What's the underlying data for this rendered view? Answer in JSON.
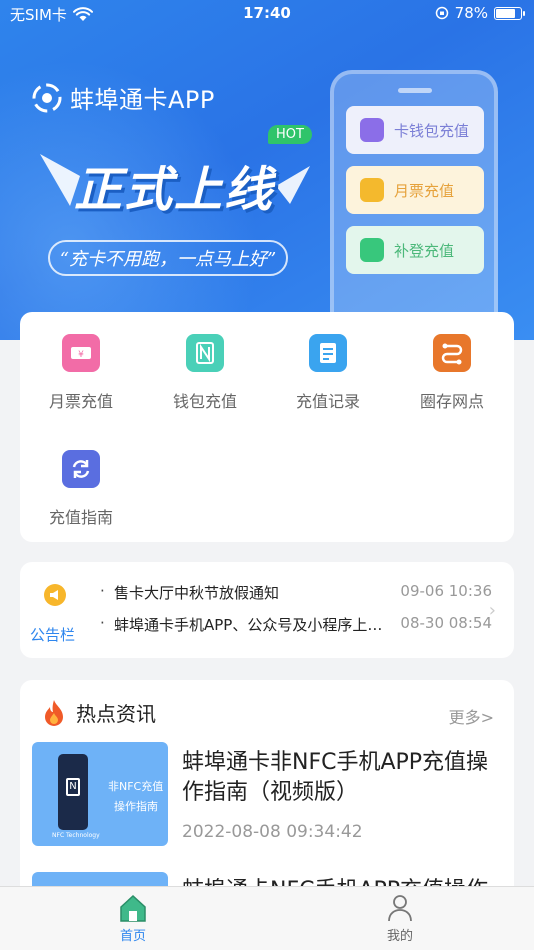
{
  "status_bar": {
    "carrier": "无SIM卡",
    "time": "17:40",
    "battery": "78%"
  },
  "banner": {
    "app_name": "蚌埠通卡APP",
    "slogan_main": "正式上线",
    "hot_badge": "HOT",
    "slogan_sub": "“充卡不用跑，一点马上好”",
    "phone_buttons": [
      {
        "label": "卡钱包充值",
        "icon": "wallet-icon",
        "bg": "#eef0fb",
        "color": "#7b7fd6",
        "icon_color": "#8b6ee8"
      },
      {
        "label": "月票充值",
        "icon": "calendar-icon",
        "bg": "#fdf3dc",
        "color": "#e6a23c",
        "icon_color": "#f4b92d"
      },
      {
        "label": "补登充值",
        "icon": "check-icon",
        "bg": "#e3f6ec",
        "color": "#4cb87a",
        "icon_color": "#38c77c"
      }
    ]
  },
  "menu": {
    "items": [
      {
        "label": "月票充值",
        "icon": "ticket-icon",
        "color": "#f26ca7"
      },
      {
        "label": "钱包充值",
        "icon": "nfc-icon",
        "color": "#4ad0b8"
      },
      {
        "label": "充值记录",
        "icon": "record-icon",
        "color": "#3aa4ef"
      },
      {
        "label": "圈存网点",
        "icon": "route-icon",
        "color": "#e8772b"
      },
      {
        "label": "充值指南",
        "icon": "refresh-icon",
        "color": "#5a6ee0"
      }
    ]
  },
  "notice": {
    "label": "公告栏",
    "items": [
      {
        "title": "售卡大厅中秋节放假通知",
        "date": "09-06 10:36"
      },
      {
        "title": "蚌埠通卡手机APP、公众号及小程序上线公告",
        "date": "08-30 08:54"
      }
    ]
  },
  "news": {
    "title": "热点资讯",
    "more": "更多>",
    "items": [
      {
        "title": "蚌埠通卡非NFC手机APP充值操作指南（视频版）",
        "date": "2022-08-08 09:34:42",
        "thumb_line1": "非NFC充值",
        "thumb_line2": "操作指南",
        "thumb_line3": "NFC Technology"
      },
      {
        "title": "蚌埠通卡NFC手机APP充值操作指南",
        "date": ""
      }
    ]
  },
  "tabbar": {
    "items": [
      {
        "label": "首页",
        "active": true,
        "color": "#2e86ee"
      },
      {
        "label": "我的",
        "active": false,
        "color": "#666666"
      }
    ]
  }
}
